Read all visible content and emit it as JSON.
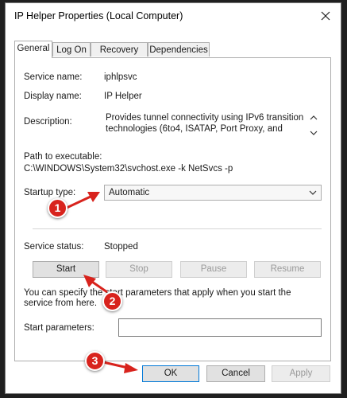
{
  "window": {
    "title": "IP Helper Properties (Local Computer)"
  },
  "tabs": [
    {
      "label": "General",
      "active": true
    },
    {
      "label": "Log On",
      "active": false
    },
    {
      "label": "Recovery",
      "active": false
    },
    {
      "label": "Dependencies",
      "active": false
    }
  ],
  "general": {
    "service_name_label": "Service name:",
    "service_name": "iphlpsvc",
    "display_name_label": "Display name:",
    "display_name": "IP Helper",
    "description_label": "Description:",
    "description": "Provides tunnel connectivity using IPv6 transition technologies (6to4, ISATAP, Port Proxy, and",
    "path_label": "Path to executable:",
    "path": "C:\\WINDOWS\\System32\\svchost.exe -k NetSvcs -p",
    "startup_type_label": "Startup type:",
    "startup_type": "Automatic",
    "service_status_label": "Service status:",
    "service_status": "Stopped",
    "buttons": {
      "start": "Start",
      "stop": "Stop",
      "pause": "Pause",
      "resume": "Resume"
    },
    "hint": "You can specify the start parameters that apply when you start the service from here.",
    "start_params_label": "Start parameters:",
    "start_params_value": ""
  },
  "footer": {
    "ok": "OK",
    "cancel": "Cancel",
    "apply": "Apply"
  },
  "annotations": [
    {
      "number": "1"
    },
    {
      "number": "2"
    },
    {
      "number": "3"
    }
  ],
  "colors": {
    "annotation": "#d8231d",
    "default_button_border": "#0078d7"
  }
}
